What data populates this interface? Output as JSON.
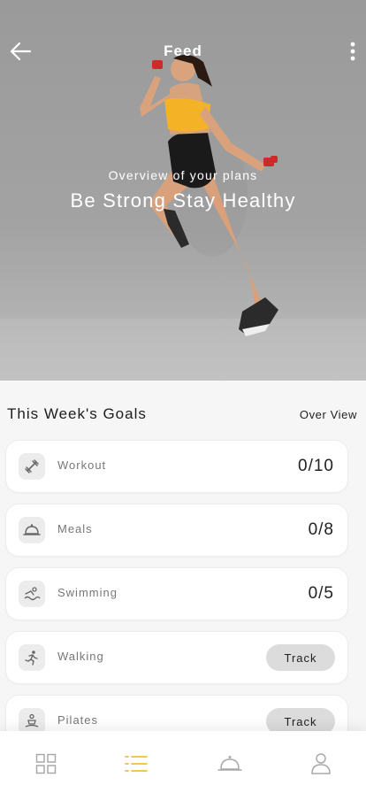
{
  "header": {
    "title": "Feed",
    "back_icon": "arrow-left-icon",
    "more_icon": "more-vertical-icon"
  },
  "hero": {
    "subtitle": "Overview of your plans",
    "title": "Be Strong Stay Healthy"
  },
  "goals": {
    "heading": "This Week's Goals",
    "overview_label": "Over View",
    "items": [
      {
        "label": "Workout",
        "value": "0/10",
        "icon": "dumbbell-icon"
      },
      {
        "label": "Meals",
        "value": "0/8",
        "icon": "cloche-icon"
      },
      {
        "label": "Swimming",
        "value": "0/5",
        "icon": "swimmer-icon"
      },
      {
        "label": "Walking",
        "action": "Track",
        "icon": "runner-icon"
      },
      {
        "label": "Pilates",
        "action": "Track",
        "icon": "meditation-icon"
      }
    ]
  },
  "bottom_nav": {
    "items": [
      {
        "icon": "grid-icon",
        "active": false
      },
      {
        "icon": "list-icon",
        "active": true
      },
      {
        "icon": "cloche-icon",
        "active": false
      },
      {
        "icon": "user-icon",
        "active": false
      }
    ]
  },
  "colors": {
    "accent": "#f2b01e",
    "card_bg": "#ffffff",
    "page_bg": "#f6f6f6",
    "track_button": "#dcdcdc",
    "inactive_icon": "#a9a9a9"
  }
}
